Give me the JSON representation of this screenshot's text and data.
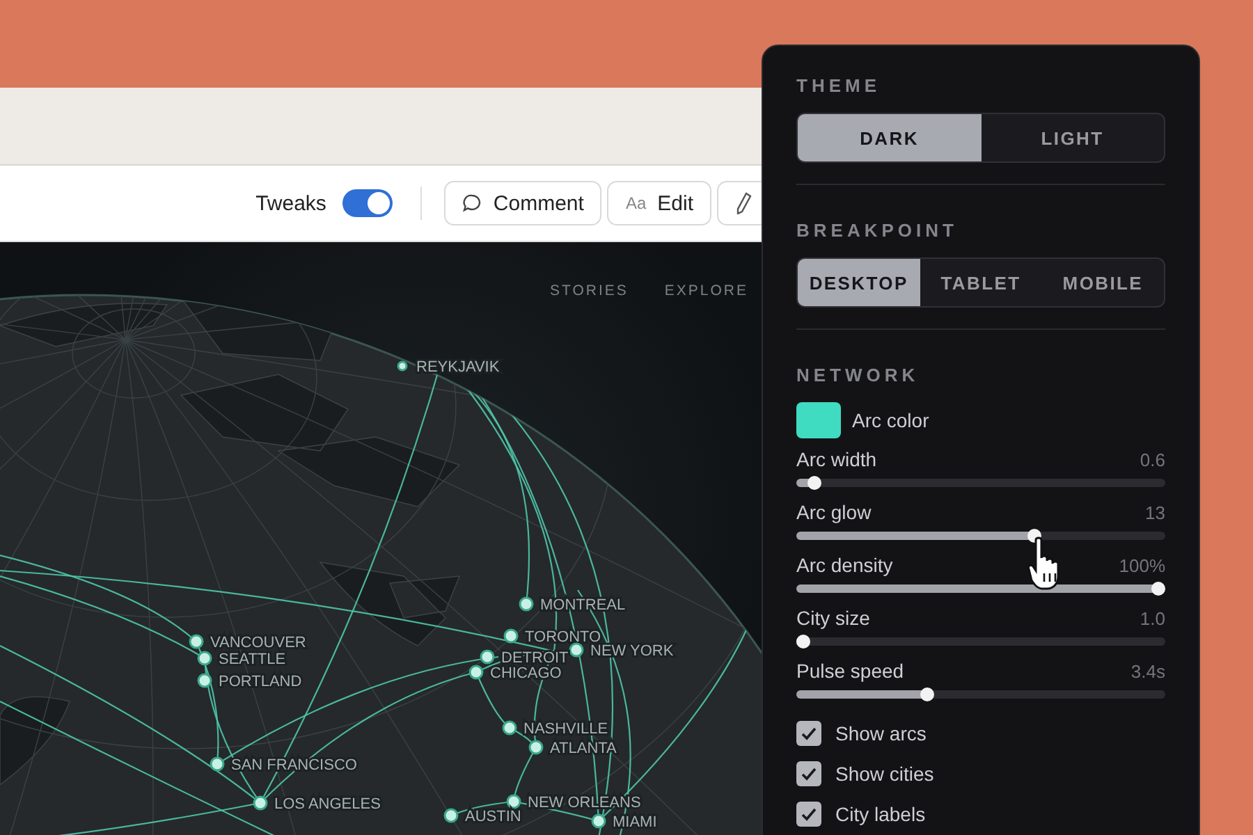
{
  "toolbar": {
    "tweaks": {
      "label": "Tweaks",
      "on": true
    },
    "buttons": [
      {
        "kind": "comment",
        "label": "Comment"
      },
      {
        "kind": "edit",
        "icon_text": "Aa",
        "label": "Edit"
      },
      {
        "kind": "pencil"
      }
    ]
  },
  "map": {
    "nav": [
      "STORIES",
      "EXPLORE"
    ],
    "cities": [
      {
        "name": "REYKJAVIK"
      },
      {
        "name": "MONTREAL"
      },
      {
        "name": "TORONTO"
      },
      {
        "name": "NEW YORK"
      },
      {
        "name": "DETROIT"
      },
      {
        "name": "CHICAGO"
      },
      {
        "name": "VANCOUVER"
      },
      {
        "name": "SEATTLE"
      },
      {
        "name": "PORTLAND"
      },
      {
        "name": "SAN FRANCISCO"
      },
      {
        "name": "LOS ANGELES"
      },
      {
        "name": "NASHVILLE"
      },
      {
        "name": "ATLANTA"
      },
      {
        "name": "NEW ORLEANS"
      },
      {
        "name": "AUSTIN"
      },
      {
        "name": "MIAMI"
      }
    ]
  },
  "panel": {
    "theme": {
      "title": "THEME",
      "options": [
        {
          "label": "DARK",
          "selected": true
        },
        {
          "label": "LIGHT",
          "selected": false
        }
      ]
    },
    "breakpoint": {
      "title": "BREAKPOINT",
      "options": [
        {
          "label": "DESKTOP",
          "selected": true
        },
        {
          "label": "TABLET",
          "selected": false
        },
        {
          "label": "MOBILE",
          "selected": false
        }
      ]
    },
    "network": {
      "title": "NETWORK",
      "arc_color": {
        "label": "Arc color",
        "color": "#3fdcc2"
      },
      "sliders": [
        {
          "label": "Arc width",
          "value": "0.6",
          "level": 0.03
        },
        {
          "label": "Arc glow",
          "value": "13",
          "level": 0.65
        },
        {
          "label": "Arc density",
          "value": "100%",
          "level": 1
        },
        {
          "label": "City size",
          "value": "1.0",
          "level": 0.0
        },
        {
          "label": "Pulse speed",
          "value": "3.4s",
          "level": 0.35
        }
      ],
      "checkboxes": [
        {
          "label": "Show arcs",
          "checked": true
        },
        {
          "label": "Show cities",
          "checked": true
        },
        {
          "label": "City labels",
          "checked": true
        }
      ]
    }
  }
}
